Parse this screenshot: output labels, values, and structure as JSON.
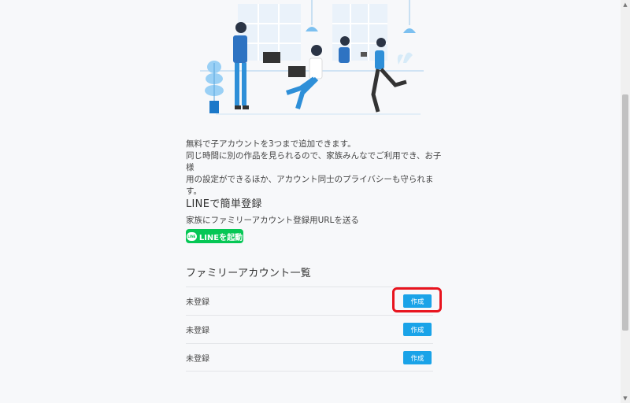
{
  "description": {
    "line1": "無料で子アカウントを3つまで追加できます。",
    "line2": "同じ時間に別の作品を見られるので、家族みんなでご利用でき、お子様",
    "line3": "用の設定ができるほか、アカウント同士のプライバシーも守られます。"
  },
  "line_section": {
    "title": "LINEで簡単登録",
    "subtitle": "家族にファミリーアカウント登録用URLを送る",
    "button_label": "LINEを起動",
    "logo_text": "LINE",
    "button_color": "#06c755"
  },
  "family_section": {
    "title": "ファミリーアカウント一覧",
    "rows": [
      {
        "status": "未登録",
        "action": "作成"
      },
      {
        "status": "未登録",
        "action": "作成"
      },
      {
        "status": "未登録",
        "action": "作成"
      }
    ]
  },
  "colors": {
    "create_button": "#1aa3e8",
    "highlight": "#e8141e",
    "background": "#f7f8fa"
  },
  "icons": {
    "hero": "people-working-illustration",
    "scroll_up": "scroll-up-arrow-icon",
    "scroll_down": "scroll-down-arrow-icon"
  }
}
